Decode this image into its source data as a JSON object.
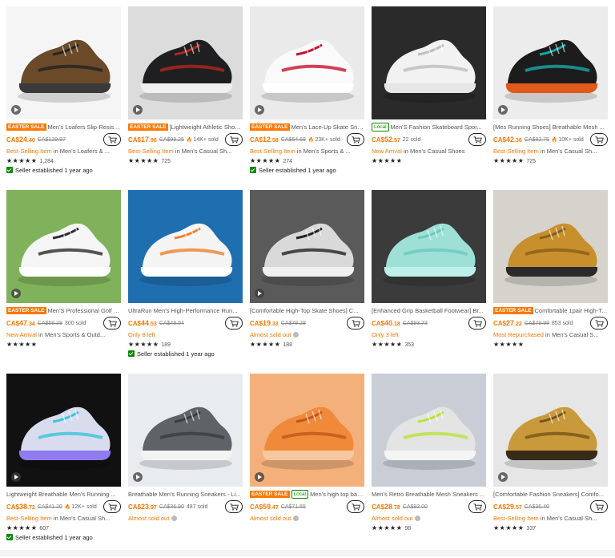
{
  "products": [
    {
      "tag": "EASTER SALE",
      "tag_type": "easter",
      "title": "Men's Loafers Slip-Resistant ...",
      "price_cur": "CA$",
      "price_int": "24",
      "price_dec": ".40",
      "old_price": "CA$129.97",
      "sold": "",
      "hot": "",
      "rank_hl": "Best-Selling Item",
      "rank_rest": " in Men's Loafers & ...",
      "rank_type": "rank",
      "stars": "★★★★★",
      "rating_count": "1,284",
      "seller": "Seller established 1 year ago",
      "img": {
        "bg": "#f5f5f5",
        "shoe": "#6b4a2a",
        "sole": "#3a3a3a",
        "accent": "#222222"
      },
      "video": true
    },
    {
      "tag": "EASTER SALE",
      "tag_type": "easter",
      "title": "[Lightweight Athletic Shoes] ...",
      "price_cur": "CA$",
      "price_int": "17",
      "price_dec": ".98",
      "old_price": "CA$98.25",
      "sold": "",
      "hot": "14K+ sold",
      "rank_hl": "Best-Selling Item",
      "rank_rest": " in Men's Casual Sh...",
      "rank_type": "rank",
      "stars": "★★★★★",
      "rating_count": "725",
      "seller": "",
      "img": {
        "bg": "#dcdcdc",
        "shoe": "#1f1f22",
        "sole": "#f0f0f0",
        "accent": "#b3261e"
      },
      "video": true
    },
    {
      "tag": "EASTER SALE",
      "tag_type": "easter",
      "title": "Men's Lace-Up Skate Sneaker...",
      "price_cur": "CA$",
      "price_int": "12",
      "price_dec": ".58",
      "old_price": "CA$64.68",
      "sold": "",
      "hot": "23K+ sold",
      "rank_hl": "Best-Selling Item",
      "rank_rest": " in Men's Sports & ...",
      "rank_type": "rank",
      "stars": "★★★★★",
      "rating_count": "274",
      "seller": "Seller established 1 year ago",
      "img": {
        "bg": "#eaeaea",
        "shoe": "#fafafa",
        "sole": "#ffffff",
        "accent": "#c8102e"
      },
      "video": true
    },
    {
      "tag": "Local",
      "tag_type": "local",
      "title": "Men'S Fashion Skateboard Spor...",
      "price_cur": "CA$",
      "price_int": "52",
      "price_dec": ".57",
      "old_price": "",
      "sold": "22 sold",
      "hot": "",
      "rank_hl": "New Arrival",
      "rank_rest": " in Men's Casual Shoes",
      "rank_type": "rank",
      "stars": "★★★★★",
      "rating_count": "",
      "seller": "",
      "img": {
        "bg": "#2a2a2a",
        "shoe": "#f2f2f2",
        "sole": "#e6e6e6",
        "accent": "#bdbdbd"
      },
      "video": false
    },
    {
      "tag": "",
      "tag_type": "",
      "title": "[Mes Running Shoes] Breathable Mesh ...",
      "price_cur": "CA$",
      "price_int": "42",
      "price_dec": ".36",
      "old_price": "CA$82.75",
      "sold": "",
      "hot": "10K+ sold",
      "rank_hl": "Best-Selling Item",
      "rank_rest": " in Men's Casual Sh...",
      "rank_type": "rank",
      "stars": "★★★★★",
      "rating_count": "725",
      "seller": "",
      "img": {
        "bg": "#ececec",
        "shoe": "#1c1c1c",
        "sole": "#e05a1a",
        "accent": "#1aa7a7"
      },
      "video": true
    },
    {
      "tag": "EASTER SALE",
      "tag_type": "easter",
      "title": "Men'S Professional Golf Foot...",
      "price_cur": "CA$",
      "price_int": "47",
      "price_dec": ".34",
      "old_price": "CA$59.29",
      "sold": "300 sold",
      "hot": "",
      "rank_hl": "New Arrival",
      "rank_rest": " in Men's Sports & Outd...",
      "rank_type": "rank",
      "stars": "★★★★★",
      "rating_count": "",
      "seller": "",
      "img": {
        "bg": "#7fb25a",
        "shoe": "#f5f5f5",
        "sole": "#ffffff",
        "accent": "#2a2a2a"
      },
      "video": true
    },
    {
      "tag": "",
      "tag_type": "",
      "title": "UltraRun Men's High-Performance Run...",
      "price_cur": "CA$",
      "price_int": "44",
      "price_dec": ".53",
      "old_price": "CA$48.64",
      "sold": "",
      "hot": "",
      "rank_hl": "Only 8 left",
      "rank_rest": "",
      "rank_type": "left",
      "stars": "★★★★★",
      "rating_count": "189",
      "seller": "Seller established 1 year ago",
      "img": {
        "bg": "#1f6fb0",
        "shoe": "#f4f4f4",
        "sole": "#ffffff",
        "accent": "#f08030"
      },
      "video": false
    },
    {
      "tag": "",
      "tag_type": "",
      "title": "[Comfortable High-Top Skate Shoes] C...",
      "price_cur": "CA$",
      "price_int": "19",
      "price_dec": ".33",
      "old_price": "CA$78.28",
      "sold": "",
      "hot": "",
      "rank_hl": "Almost sold out",
      "rank_rest": "",
      "rank_type": "almost",
      "stars": "★★★★★",
      "rating_count": "188",
      "seller": "",
      "img": {
        "bg": "#5a5a5a",
        "shoe": "#d9d9d9",
        "sole": "#f0f0f0",
        "accent": "#222222"
      },
      "video": true
    },
    {
      "tag": "",
      "tag_type": "",
      "title": "[Enhanced Grip Basketball Footwear] Br...",
      "price_cur": "CA$",
      "price_int": "40",
      "price_dec": ".18",
      "old_price": "CA$93.73",
      "sold": "",
      "hot": "",
      "rank_hl": "Only 3 left",
      "rank_rest": "",
      "rank_type": "left",
      "stars": "★★★★★",
      "rating_count": "353",
      "seller": "",
      "img": {
        "bg": "#3b3b3b",
        "shoe": "#9ee0d6",
        "sole": "#bdf0e8",
        "accent": "#6cc9bd"
      },
      "video": false
    },
    {
      "tag": "EASTER SALE",
      "tag_type": "easter",
      "title": "Comfortable 1pair High-Top ...",
      "price_cur": "CA$",
      "price_int": "27",
      "price_dec": ".22",
      "old_price": "CA$79.98",
      "sold": "853 sold",
      "hot": "",
      "rank_hl": "Most Repurchased",
      "rank_rest": " in Men's Casual S...",
      "rank_type": "rank",
      "stars": "★★★★★",
      "rating_count": "",
      "seller": "",
      "img": {
        "bg": "#d6d2cc",
        "shoe": "#c7902c",
        "sole": "#2a2a2a",
        "accent": "#8a5e18"
      },
      "video": false
    },
    {
      "tag": "",
      "tag_type": "",
      "title": "Lightweight Breathable Men's Running ...",
      "price_cur": "CA$",
      "price_int": "38",
      "price_dec": ".72",
      "old_price": "CA$41.20",
      "sold": "",
      "hot": "12K+ sold",
      "rank_hl": "Best-Selling Item",
      "rank_rest": " in Men's Casual Sh...",
      "rank_type": "rank",
      "stars": "★★★★★",
      "rating_count": "607",
      "seller": "Seller established 1 year ago",
      "img": {
        "bg": "#111111",
        "shoe": "#d9dcef",
        "sole": "#8e7cf0",
        "accent": "#39c6d6"
      },
      "video": true
    },
    {
      "tag": "",
      "tag_type": "",
      "title": "Breathable Men's Running Sneakers - Li...",
      "price_cur": "CA$",
      "price_int": "23",
      "price_dec": ".97",
      "old_price": "CA$36.90",
      "sold": "487 sold",
      "hot": "",
      "rank_hl": "Almost sold out",
      "rank_rest": "",
      "rank_type": "almost",
      "stars": "",
      "rating_count": "",
      "seller": "",
      "img": {
        "bg": "#e9ecef",
        "shoe": "#5f6368",
        "sole": "#f3f3f3",
        "accent": "#3a3d40"
      },
      "video": true
    },
    {
      "tag": "EASTER SALE",
      "tag_type": "easter",
      "tag2": "Local",
      "title": "Men's high top baske...",
      "price_cur": "CA$",
      "price_int": "59",
      "price_dec": ".47",
      "old_price": "CA$71.65",
      "sold": "",
      "hot": "",
      "rank_hl": "Almost sold out",
      "rank_rest": "",
      "rank_type": "almost",
      "stars": "",
      "rating_count": "",
      "seller": "",
      "img": {
        "bg": "#f3b07a",
        "shoe": "#f08a3a",
        "sole": "#f7c7a0",
        "accent": "#c0561a"
      },
      "video": true
    },
    {
      "tag": "",
      "tag_type": "",
      "title": "Men's Retro Breathable Mesh Sneakers ...",
      "price_cur": "CA$",
      "price_int": "28",
      "price_dec": ".78",
      "old_price": "CA$92.00",
      "sold": "",
      "hot": "",
      "rank_hl": "Almost sold out",
      "rank_rest": "",
      "rank_type": "almost",
      "stars": "★★★★★",
      "rating_count": "98",
      "seller": "",
      "img": {
        "bg": "#c9ced6",
        "shoe": "#e4e4e4",
        "sole": "#f4f4f4",
        "accent": "#b9e23a"
      },
      "video": false
    },
    {
      "tag": "",
      "tag_type": "",
      "title": "[Comfortable Fashion Sneakers] Comfo...",
      "price_cur": "CA$",
      "price_int": "29",
      "price_dec": ".57",
      "old_price": "CA$36.40",
      "sold": "",
      "hot": "",
      "rank_hl": "Best-Selling Item",
      "rank_rest": " in Men's Casual Sh...",
      "rank_type": "rank",
      "stars": "★★★★★",
      "rating_count": "337",
      "seller": "",
      "img": {
        "bg": "#e6e6e6",
        "shoe": "#c99a3b",
        "sole": "#3a2a1a",
        "accent": "#7a5418"
      },
      "video": true
    }
  ]
}
